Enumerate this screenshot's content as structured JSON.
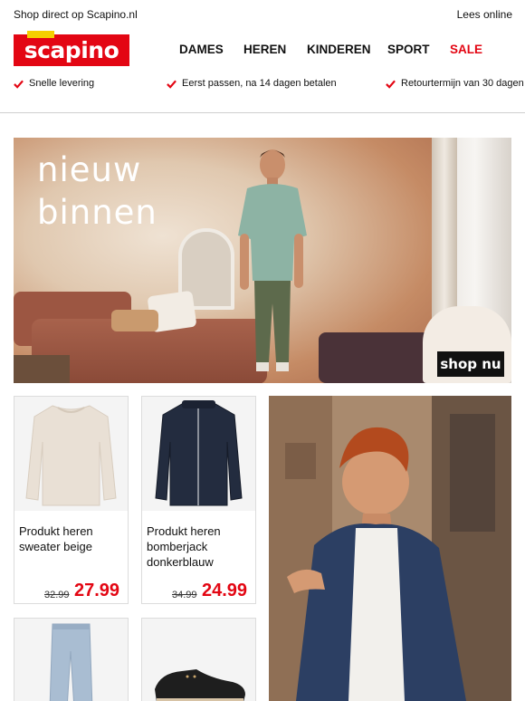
{
  "topbar": {
    "shop_text": "Shop direct op Scapino.nl",
    "read_online": "Lees online"
  },
  "brand": {
    "logo_text": "scapino",
    "primary_color": "#e30613",
    "accent_color": "#f5d000"
  },
  "nav": {
    "items": [
      {
        "label": "DAMES"
      },
      {
        "label": "HEREN"
      },
      {
        "label": "KINDEREN"
      },
      {
        "label": "SPORT"
      },
      {
        "label": "SALE"
      }
    ]
  },
  "usps": [
    {
      "icon": "check-icon",
      "label": "Snelle levering"
    },
    {
      "icon": "check-icon",
      "label": "Eerst passen, na 14 dagen betalen"
    },
    {
      "icon": "check-icon",
      "label": "Retourtermijn van 30 dagen"
    }
  ],
  "hero": {
    "headline_line1": "nieuw",
    "headline_line2": "binnen",
    "cta": "shop nu"
  },
  "products": [
    {
      "name": "Produkt heren sweater beige",
      "old_price": "32.99",
      "price": "27.99"
    },
    {
      "name": "Produkt heren bomberjack donkerblauw",
      "old_price": "34.99",
      "price": "24.99"
    },
    {
      "name": "",
      "old_price": "",
      "price": ""
    },
    {
      "name": "",
      "old_price": "",
      "price": ""
    }
  ]
}
